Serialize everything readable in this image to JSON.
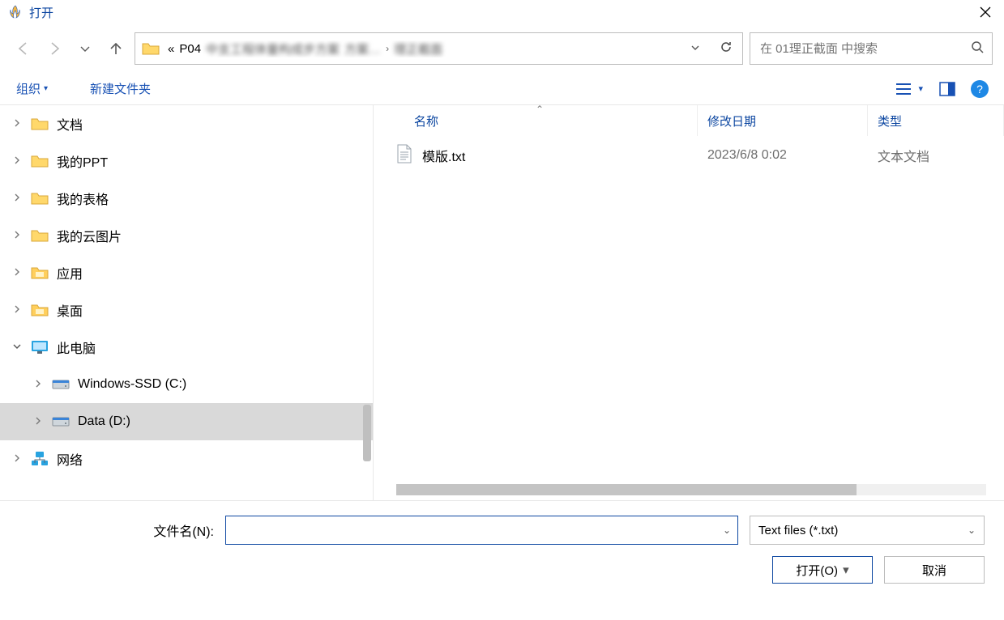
{
  "window": {
    "title": "打开"
  },
  "nav": {
    "crumb_prefix": "«",
    "crumb1": "P04",
    "crumb1_blur": "中支工程体量构成步方案",
    "crumb2_blur": "方案…",
    "crumb3_blur": "理正截面",
    "sep": "›"
  },
  "search": {
    "placeholder": "在 01理正截面 中搜索"
  },
  "toolbar": {
    "organize": "组织",
    "newfolder": "新建文件夹"
  },
  "tree": [
    {
      "id": "docs",
      "label": "文档",
      "icon": "folder",
      "indent": 0,
      "expander": ">"
    },
    {
      "id": "myppt",
      "label": "我的PPT",
      "icon": "folder",
      "indent": 0,
      "expander": ">"
    },
    {
      "id": "mysheet",
      "label": "我的表格",
      "icon": "folder",
      "indent": 0,
      "expander": ">"
    },
    {
      "id": "mycloud",
      "label": "我的云图片",
      "icon": "folder",
      "indent": 0,
      "expander": ">"
    },
    {
      "id": "apps",
      "label": "应用",
      "icon": "folder-app",
      "indent": 0,
      "expander": ">"
    },
    {
      "id": "desktop",
      "label": "桌面",
      "icon": "folder-app",
      "indent": 0,
      "expander": ">"
    },
    {
      "id": "thispc",
      "label": "此电脑",
      "icon": "monitor",
      "indent": 0,
      "expander": "v"
    },
    {
      "id": "cdrive",
      "label": "Windows-SSD (C:)",
      "icon": "drive",
      "indent": 1,
      "expander": ">"
    },
    {
      "id": "ddrive",
      "label": "Data (D:)",
      "icon": "drive",
      "indent": 1,
      "expander": ">",
      "selected": true
    },
    {
      "id": "network",
      "label": "网络",
      "icon": "network",
      "indent": 0,
      "expander": ">"
    }
  ],
  "columns": {
    "name": "名称",
    "date": "修改日期",
    "type": "类型"
  },
  "files": [
    {
      "name": "模版.txt",
      "date": "2023/6/8 0:02",
      "type": "文本文档"
    }
  ],
  "bottom": {
    "filename_label": "文件名(N):",
    "filename_value": "",
    "filetype": "Text files (*.txt)",
    "open": "打开(O)",
    "cancel": "取消"
  }
}
